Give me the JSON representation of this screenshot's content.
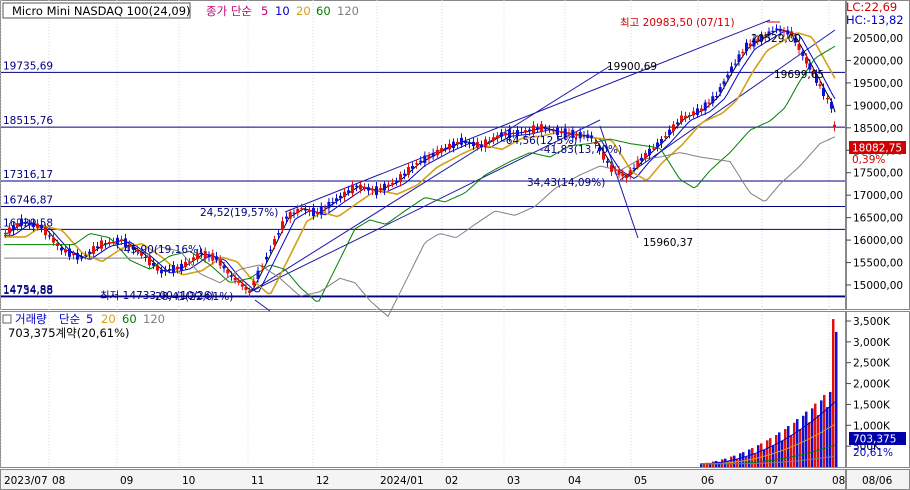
{
  "header": {
    "title": "Micro Mini NASDAQ 100(24,09)",
    "ma_label": "종가 단순",
    "ma_periods": [
      "5",
      "10",
      "20",
      "60",
      "120"
    ],
    "ma_colors": [
      "#000000",
      "#0000cc",
      "#d4a017",
      "#008000",
      "#808080"
    ]
  },
  "right_top": {
    "lc": "LC:22,69",
    "hc": "HC:-13,82"
  },
  "price_axis": {
    "ticks": [
      "20500,00",
      "20000,00",
      "19500,00",
      "19000,00",
      "18500,00",
      "18000,00",
      "17500,00",
      "17000,00",
      "16500,00",
      "16000,00",
      "15500,00",
      "15000,00"
    ],
    "current_price": "18082,75",
    "current_change": "0,39%"
  },
  "hlines": [
    {
      "label": "19735,69",
      "value": 19735.69
    },
    {
      "label": "18515,76",
      "value": 18515.76
    },
    {
      "label": "17316,17",
      "value": 17316.17
    },
    {
      "label": "16746,87",
      "value": 16746.87
    },
    {
      "label": "16239,58",
      "value": 16239.58
    },
    {
      "label": "14754,88",
      "value": 14754.88
    },
    {
      "label": "14734,88",
      "value": 14734.88
    }
  ],
  "annotations": {
    "high": "최고 20983,50 (07/11)",
    "low": "최저 14733,00 (10/26)",
    "p20529": "20529,00",
    "p19699": "19699,65",
    "p19900": "19900,69",
    "p15960": "15960,37",
    "r1": "24,52(19,57%)",
    "r2": "-45,90(19,16%)",
    "r3": "-64,56(12,5%)",
    "r4": "-41,83(13,70%)",
    "r5": "34,43(14,09%)",
    "r6": "28,41(22,01%)"
  },
  "volume": {
    "label": "거래량",
    "ma_label": "단순",
    "ma_periods": [
      "5",
      "20",
      "60",
      "120"
    ],
    "ma_colors": [
      "#0000cc",
      "#d4a017",
      "#008000",
      "#808080"
    ],
    "current": "703,375계약(20,61%)",
    "axis_ticks": [
      "3,500K",
      "3,000K",
      "2,500K",
      "2,000K",
      "1,500K",
      "1,000K",
      "500K"
    ],
    "badge_value": "703,375",
    "badge_pct": "20,61%"
  },
  "time_axis": {
    "labels": [
      "2023/07",
      "08",
      "09",
      "10",
      "11",
      "12",
      "2024/01",
      "02",
      "03",
      "04",
      "05",
      "06",
      "07",
      "08",
      "08/06"
    ]
  },
  "chart_data": {
    "type": "candlestick",
    "title": "Micro Mini NASDAQ 100(24,09)",
    "x_range": [
      "2023/07",
      "2024/08/06"
    ],
    "price_ylim": [
      14600,
      21100
    ],
    "volume_ylim": [
      0,
      3700
    ],
    "volume_unit": "K",
    "close_series": [
      {
        "month": "2023/07",
        "close": 16100
      },
      {
        "month": "2023/08",
        "close": 15900
      },
      {
        "month": "2023/09",
        "close": 15400
      },
      {
        "month": "2023/10",
        "close": 15500
      },
      {
        "month": "2023/11",
        "close": 16400
      },
      {
        "month": "2023/12",
        "close": 16900
      },
      {
        "month": "2024/01",
        "close": 17600
      },
      {
        "month": "2024/02",
        "close": 18100
      },
      {
        "month": "2024/03",
        "close": 18600
      },
      {
        "month": "2024/04",
        "close": 17500
      },
      {
        "month": "2024/05",
        "close": 18800
      },
      {
        "month": "2024/06",
        "close": 19800
      },
      {
        "month": "2024/07",
        "close": 19600
      },
      {
        "month": "2024/08",
        "close": 18082.75
      }
    ],
    "last_close": 18082.75,
    "high": 20983.5,
    "low": 14733
  }
}
